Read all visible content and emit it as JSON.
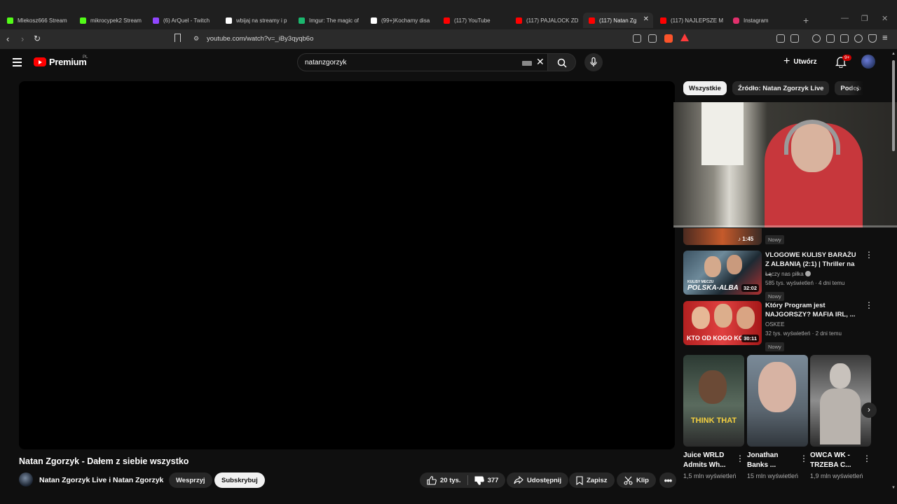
{
  "browser": {
    "tabs": [
      {
        "label": "Mlekosz666 Stream",
        "fav": "#53fc18"
      },
      {
        "label": "mikrocypek2 Stream",
        "fav": "#53fc18"
      },
      {
        "label": "(6) ArQuel - Twitch",
        "fav": "#9146ff"
      },
      {
        "label": "wbijaj na streamy i p",
        "fav": "#ffffff"
      },
      {
        "label": "Imgur: The magic of",
        "fav": "#1bb76e"
      },
      {
        "label": "(99+)Kochamy disa",
        "fav": "#ffffff"
      },
      {
        "label": "(117) YouTube",
        "fav": "#ff0000"
      },
      {
        "label": "(117) PAJALOCK ZD",
        "fav": "#ff0000"
      },
      {
        "label": "(117) Natan Zg",
        "fav": "#ff0000"
      },
      {
        "label": "(117) NAJLEPSZE M",
        "fav": "#ff0000"
      },
      {
        "label": "Instagram",
        "fav": "#e1306c"
      }
    ],
    "url": "youtube.com/watch?v=_iBy3qyqb6o"
  },
  "header": {
    "brand": "Premium",
    "region": "PL",
    "search_value": "natanzgorzyk",
    "create_label": "Utwórz",
    "notifications": "9+"
  },
  "video": {
    "title": "Natan Zgorzyk - Dałem z siebie wszystko",
    "channel": "Natan Zgorzyk Live i Natan Zgorzyk",
    "support": "Wesprzyj",
    "subscribe": "Subskrybuj",
    "likes": "20 tys.",
    "dislikes": "377",
    "share": "Udostępnij",
    "save": "Zapisz",
    "clip": "Klip"
  },
  "sidebar": {
    "chips": [
      "Wszystkie",
      "Źródło: Natan Zgorzyk Live",
      "Podob"
    ],
    "partial": {
      "duration": "1:45",
      "badge": "Nowy"
    },
    "recs": [
      {
        "title": "VLOGOWE KULISY BARAŻU Z ALBANIĄ (2:1) | Thriller na ...",
        "channel": "Łączy nas piłka",
        "meta": "585 tys. wyświetleń · 4 dni temu",
        "badge": "Nowy",
        "duration": "32:02",
        "thumb_text": "POLSKA-ALBA",
        "thumb_sub": "KULISY MECZU"
      },
      {
        "title": "Który Program jest NAJGORSZY? MAFIA IRL, ...",
        "channel": "OSKEE",
        "meta": "32 tys. wyświetleń · 2 dni temu",
        "badge": "Nowy",
        "duration": "30:11",
        "thumb_text": "KTO OD KOGO KOP"
      }
    ],
    "shorts": [
      {
        "title": "Juice WRLD Admits Wh...",
        "views": "1,5 mln wyświetleń",
        "overlay": "THINK THAT"
      },
      {
        "title": "Jonathan Banks ...",
        "views": "15 mln wyświetleń",
        "overlay": ""
      },
      {
        "title": "OWCA WK - TRZEBA C...",
        "views": "1,9 mln wyświetleń",
        "overlay": ""
      }
    ]
  }
}
